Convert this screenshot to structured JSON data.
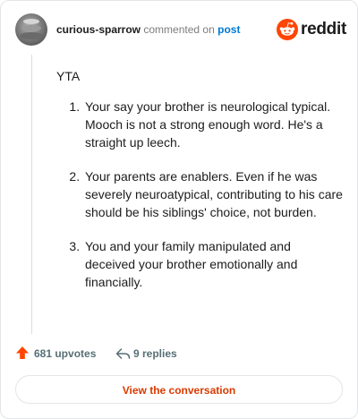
{
  "comment": {
    "username": "curious-sparrow",
    "commented_on": "commented on",
    "post_link": "post",
    "brand": "reddit",
    "intro": "YTA",
    "points": [
      "Your say your brother is neurological typical. Mooch is not a strong enough word. He's a straight up leech.",
      "Your parents are enablers. Even if he was severely neuroatypical, contributing to his care should be his siblings' choice, not burden.",
      "You and your family manipulated and deceived your brother emotionally and financially."
    ]
  },
  "footer": {
    "upvotes": "681 upvotes",
    "replies": "9 replies"
  },
  "cta": {
    "label": "View the conversation"
  },
  "colors": {
    "brand_orange": "#ff4500",
    "link_blue": "#0079d3",
    "cta_text": "#d93a00",
    "meta_gray": "#576f76"
  },
  "icons": {
    "upvote": "upvote-arrow-icon",
    "reply": "reply-arrow-icon",
    "brand": "reddit-snoo-icon"
  }
}
